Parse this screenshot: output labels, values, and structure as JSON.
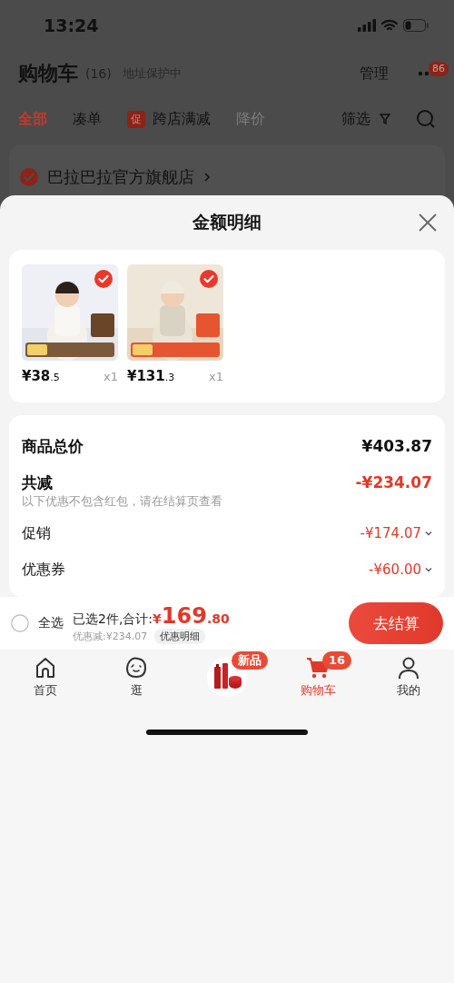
{
  "status_bar": {
    "time": "13:24"
  },
  "header": {
    "title": "购物车",
    "count": "(16)",
    "address": "地址保护中",
    "manage": "管理",
    "more_badge": "86"
  },
  "filter_tabs": [
    {
      "label": "全部",
      "selected": true,
      "disabled": false
    },
    {
      "label": "凑单",
      "selected": false,
      "disabled": false
    },
    {
      "label": "跨店满减",
      "badge": "促",
      "selected": false,
      "disabled": false
    },
    {
      "label": "降价",
      "selected": false,
      "disabled": true
    }
  ],
  "filter_button": "筛选",
  "store": {
    "name": "巴拉巴拉官方旗舰店",
    "checked": true
  },
  "sheet": {
    "title": "金额明细",
    "products": [
      {
        "kind": "picture",
        "price": "¥38",
        "price_decimal": ".5",
        "quantity": "x1",
        "checked": true
      },
      {
        "kind": "picture",
        "price": "¥131",
        "price_decimal": ".3",
        "quantity": "x1",
        "checked": true
      }
    ],
    "total": {
      "label": "商品总价",
      "value": "¥403.87"
    },
    "discount": {
      "label": "共减",
      "value": "-¥234.07",
      "note": "以下优惠不包含红包，请在结算页查看"
    },
    "discount_items": [
      {
        "label": "促销",
        "value": "-¥174.07",
        "expanded": false
      },
      {
        "label": "优惠券",
        "value": "-¥60.00",
        "expanded": false
      }
    ]
  },
  "checkout": {
    "select_all": {
      "label": "全选",
      "checked": false
    },
    "summary": "已选2件,合计:",
    "currency": "¥",
    "amount": "169",
    "amount_decimal": ".80",
    "saving": "优惠减:¥234.07",
    "detail_button": "优惠明细",
    "checkout_button": "去结算"
  },
  "nav": [
    {
      "kind": "home",
      "label": "首页",
      "selected": false
    },
    {
      "kind": "face",
      "label": "逛",
      "selected": false
    },
    {
      "kind": "promo",
      "badge": "新品",
      "selected": false
    },
    {
      "kind": "cart",
      "label": "购物车",
      "badge": "16",
      "selected": true
    },
    {
      "kind": "user",
      "label": "我的",
      "selected": false
    }
  ]
}
